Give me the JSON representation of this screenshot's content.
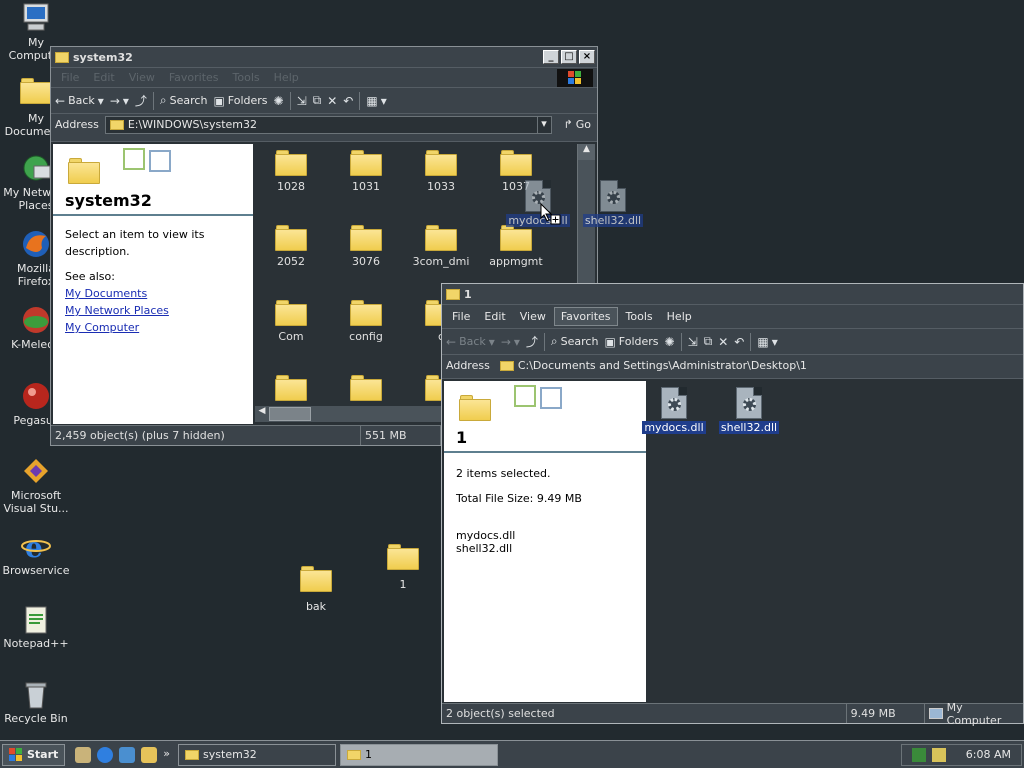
{
  "desktop": {
    "icons": [
      {
        "label": "My Computer"
      },
      {
        "label": "My Documents"
      },
      {
        "label": "My Network Places"
      },
      {
        "label": "Mozilla Firefox"
      },
      {
        "label": "K-Meleon"
      },
      {
        "label": "Pegasus"
      },
      {
        "label": "Microsoft Visual Stu..."
      },
      {
        "label": "Browservice"
      },
      {
        "label": "Notepad++"
      },
      {
        "label": "Recycle Bin"
      }
    ],
    "folders": [
      {
        "label": "bak"
      },
      {
        "label": "1"
      }
    ],
    "drag_ghost": [
      {
        "label": "mydocs.dll"
      },
      {
        "label": "shell32.dll"
      }
    ]
  },
  "win1": {
    "title": "system32",
    "menu": [
      "File",
      "Edit",
      "View",
      "Favorites",
      "Tools",
      "Help"
    ],
    "toolbar": {
      "back": "Back",
      "search": "Search",
      "folders": "Folders"
    },
    "address_label": "Address",
    "address": "E:\\WINDOWS\\system32",
    "go": "Go",
    "pane_title": "system32",
    "pane_desc": "Select an item to view its description.",
    "see_also": "See also:",
    "links": [
      "My Documents",
      "My Network Places",
      "My Computer"
    ],
    "items": [
      "1028",
      "1031",
      "1033",
      "1037",
      "2052",
      "3076",
      "3com_dmi",
      "appmgmt",
      "Com",
      "config",
      "c"
    ],
    "status_count": "2,459 object(s) (plus 7 hidden)",
    "status_size": "551 MB"
  },
  "win2": {
    "title": "1",
    "menu": [
      "File",
      "Edit",
      "View",
      "Favorites",
      "Tools",
      "Help"
    ],
    "toolbar": {
      "back": "Back",
      "search": "Search",
      "folders": "Folders"
    },
    "address_label": "Address",
    "address": "C:\\Documents and Settings\\Administrator\\Desktop\\1",
    "pane_title": "1",
    "selected": "2 items selected.",
    "total": "Total File Size: 9.49 MB",
    "files": [
      "mydocs.dll",
      "shell32.dll"
    ],
    "status_sel": "2 object(s) selected",
    "status_size": "9.49 MB",
    "status_loc": "My Computer"
  },
  "taskbar": {
    "start": "Start",
    "tasks": [
      "system32",
      "1"
    ],
    "clock": "6:08 AM"
  }
}
